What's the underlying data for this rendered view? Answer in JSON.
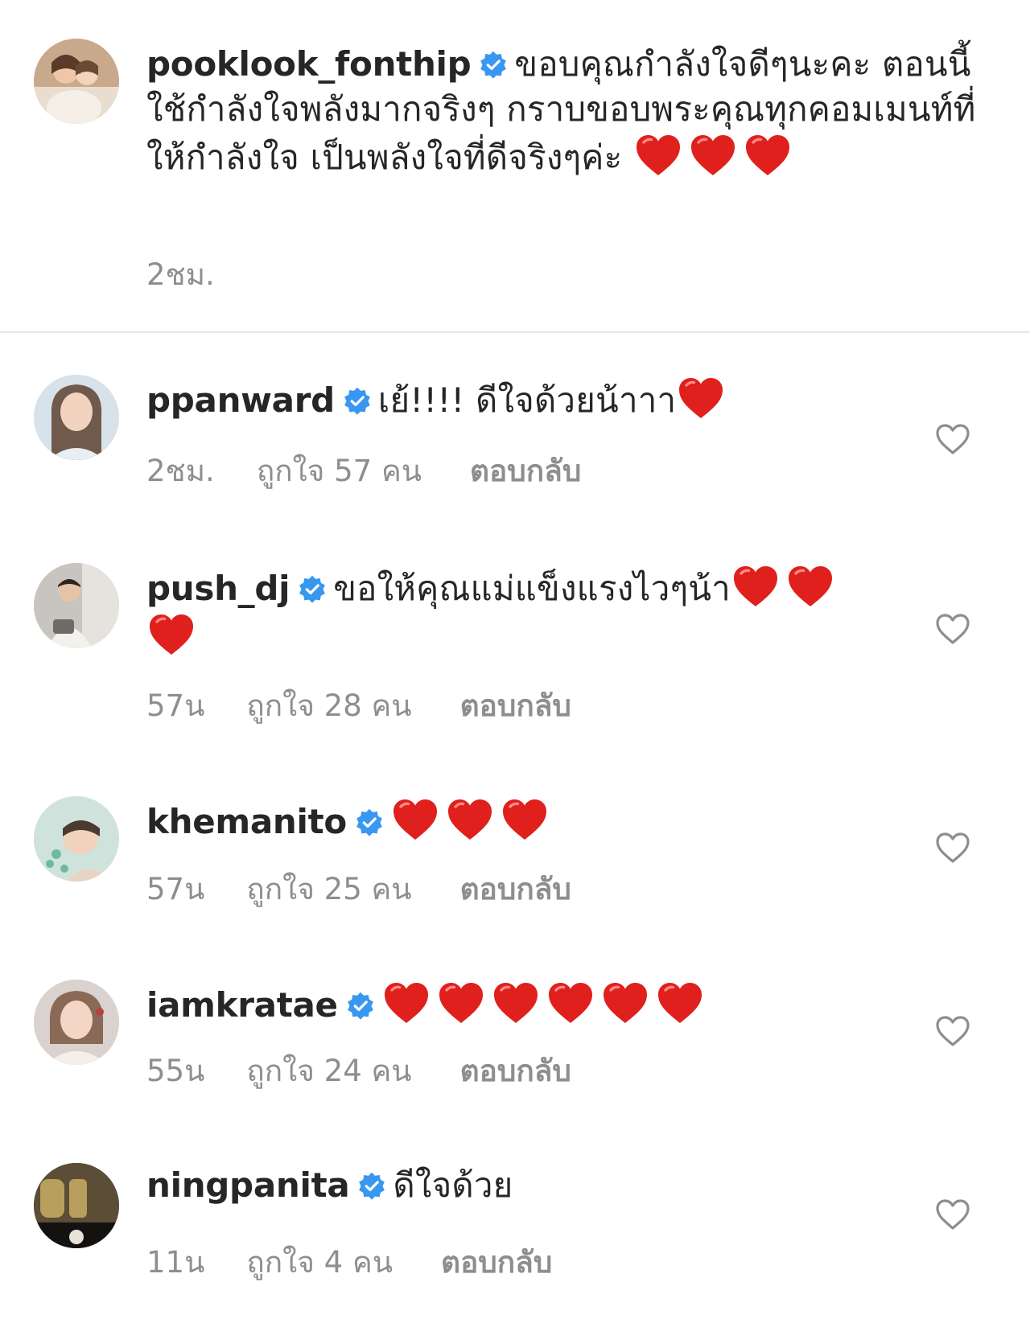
{
  "caption": {
    "username": "pooklook_fonthip",
    "text": "ขอบคุณกำลังใจดีๆนะคะ ตอนนี้ใช้กำลังใจพลังมากจริงๆ กราบขอบพระคุณทุกคอมเมนท์ที่ให้กำลังใจ เป็นพลังใจที่ดีจริงๆค่ะ",
    "heart_count": 3,
    "time": "2ชม."
  },
  "comments": [
    {
      "username": "ppanward",
      "text": "เย้!!!! ดีใจด้วยน้าาา",
      "heart_count": 1,
      "time": "2ชม.",
      "likes": "ถูกใจ 57 คน",
      "reply": "ตอบกลับ"
    },
    {
      "username": "push_dj",
      "text": "ขอให้คุณแม่แข็งแรงไวๆน้า",
      "heart_count": 3,
      "time": "57น",
      "likes": "ถูกใจ 28 คน",
      "reply": "ตอบกลับ"
    },
    {
      "username": "khemanito",
      "text": "",
      "heart_count": 3,
      "time": "57น",
      "likes": "ถูกใจ 25 คน",
      "reply": "ตอบกลับ"
    },
    {
      "username": "iamkratae",
      "text": "",
      "heart_count": 6,
      "time": "55น",
      "likes": "ถูกใจ 24 คน",
      "reply": "ตอบกลับ"
    },
    {
      "username": "ningpanita",
      "text": "ดีใจด้วย",
      "heart_count": 0,
      "time": "11น",
      "likes": "ถูกใจ 4 คน",
      "reply": "ตอบกลับ"
    }
  ],
  "icons": {
    "verified": "verified-badge-icon",
    "heart_emoji": "red-heart-emoji-icon",
    "like": "heart-outline-icon"
  },
  "colors": {
    "verified_blue": "#3897f0",
    "heart_red": "#e0201c",
    "meta_gray": "#8e8e8e",
    "text": "#262626"
  }
}
